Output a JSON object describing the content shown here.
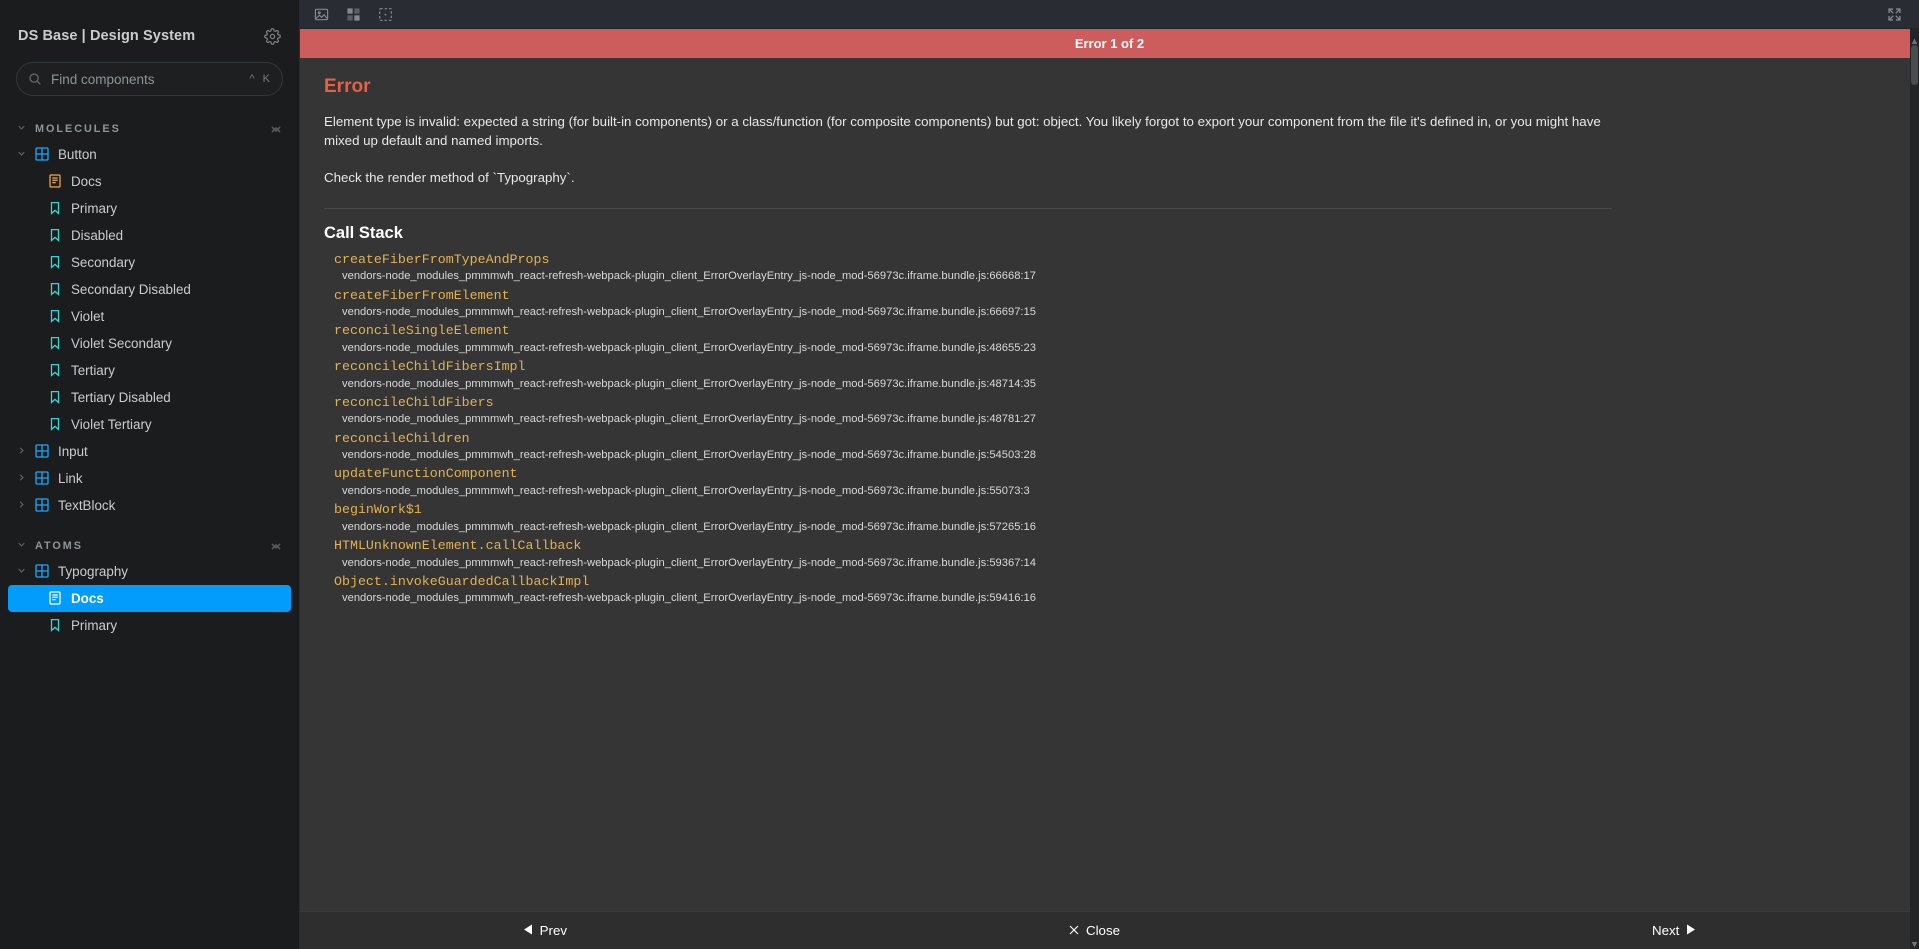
{
  "sidebar": {
    "title": "DS Base | Design System",
    "settings_icon": "gear-icon",
    "search": {
      "placeholder": "Find components",
      "value": "",
      "icon": "search-icon",
      "shortcut_modifier": "^",
      "shortcut_key": "K"
    },
    "groups": [
      {
        "label": "MOLECULES",
        "expanded": true,
        "items": [
          {
            "label": "Button",
            "icon": "component-grid-icon",
            "type": "component",
            "expanded": true,
            "children": [
              {
                "label": "Docs",
                "icon": "docs-page-icon",
                "type": "docs",
                "selected": false
              },
              {
                "label": "Primary",
                "icon": "story-bookmark-icon",
                "type": "story",
                "selected": false
              },
              {
                "label": "Disabled",
                "icon": "story-bookmark-icon",
                "type": "story",
                "selected": false
              },
              {
                "label": "Secondary",
                "icon": "story-bookmark-icon",
                "type": "story",
                "selected": false
              },
              {
                "label": "Secondary Disabled",
                "icon": "story-bookmark-icon",
                "type": "story",
                "selected": false
              },
              {
                "label": "Violet",
                "icon": "story-bookmark-icon",
                "type": "story",
                "selected": false
              },
              {
                "label": "Violet Secondary",
                "icon": "story-bookmark-icon",
                "type": "story",
                "selected": false
              },
              {
                "label": "Tertiary",
                "icon": "story-bookmark-icon",
                "type": "story",
                "selected": false
              },
              {
                "label": "Tertiary Disabled",
                "icon": "story-bookmark-icon",
                "type": "story",
                "selected": false
              },
              {
                "label": "Violet Tertiary",
                "icon": "story-bookmark-icon",
                "type": "story",
                "selected": false
              }
            ]
          },
          {
            "label": "Input",
            "icon": "component-grid-icon",
            "type": "component",
            "expanded": false,
            "children": []
          },
          {
            "label": "Link",
            "icon": "component-grid-icon",
            "type": "component",
            "expanded": false,
            "children": []
          },
          {
            "label": "TextBlock",
            "icon": "component-grid-icon",
            "type": "component",
            "expanded": false,
            "children": []
          }
        ]
      },
      {
        "label": "ATOMS",
        "expanded": true,
        "items": [
          {
            "label": "Typography",
            "icon": "component-grid-icon",
            "type": "component",
            "expanded": true,
            "children": [
              {
                "label": "Docs",
                "icon": "docs-page-icon",
                "type": "docs",
                "selected": true
              },
              {
                "label": "Primary",
                "icon": "story-bookmark-icon",
                "type": "story",
                "selected": false
              }
            ]
          }
        ]
      }
    ]
  },
  "toolbar": {
    "buttons": [
      {
        "name": "change-background-icon",
        "title": "Change the background of the preview"
      },
      {
        "name": "grid-icon",
        "title": "Apply a grid to the preview"
      },
      {
        "name": "measure-icon",
        "title": "Enable measure"
      }
    ],
    "fullscreen": {
      "name": "fullscreen-icon",
      "title": "Go full screen"
    }
  },
  "error_overlay": {
    "banner": "Error 1 of 2",
    "heading": "Error",
    "message_1": "Element type is invalid: expected a string (for built-in components) or a class/function (for composite components) but got: object. You likely forgot to export your component from the file it's defined in, or you might have mixed up default and named imports.",
    "message_2": "Check the render method of `Typography`.",
    "stack_title": "Call Stack",
    "frames": [
      {
        "fn": "createFiberFromTypeAndProps",
        "src": "vendors-node_modules_pmmmwh_react-refresh-webpack-plugin_client_ErrorOverlayEntry_js-node_mod-56973c.iframe.bundle.js:66668:17"
      },
      {
        "fn": "createFiberFromElement",
        "src": "vendors-node_modules_pmmmwh_react-refresh-webpack-plugin_client_ErrorOverlayEntry_js-node_mod-56973c.iframe.bundle.js:66697:15"
      },
      {
        "fn": "reconcileSingleElement",
        "src": "vendors-node_modules_pmmmwh_react-refresh-webpack-plugin_client_ErrorOverlayEntry_js-node_mod-56973c.iframe.bundle.js:48655:23"
      },
      {
        "fn": "reconcileChildFibersImpl",
        "src": "vendors-node_modules_pmmmwh_react-refresh-webpack-plugin_client_ErrorOverlayEntry_js-node_mod-56973c.iframe.bundle.js:48714:35"
      },
      {
        "fn": "reconcileChildFibers",
        "src": "vendors-node_modules_pmmmwh_react-refresh-webpack-plugin_client_ErrorOverlayEntry_js-node_mod-56973c.iframe.bundle.js:48781:27"
      },
      {
        "fn": "reconcileChildren",
        "src": "vendors-node_modules_pmmmwh_react-refresh-webpack-plugin_client_ErrorOverlayEntry_js-node_mod-56973c.iframe.bundle.js:54503:28"
      },
      {
        "fn": "updateFunctionComponent",
        "src": "vendors-node_modules_pmmmwh_react-refresh-webpack-plugin_client_ErrorOverlayEntry_js-node_mod-56973c.iframe.bundle.js:55073:3"
      },
      {
        "fn": "beginWork$1",
        "src": "vendors-node_modules_pmmmwh_react-refresh-webpack-plugin_client_ErrorOverlayEntry_js-node_mod-56973c.iframe.bundle.js:57265:16"
      },
      {
        "fn": "HTMLUnknownElement.callCallback",
        "src": "vendors-node_modules_pmmmwh_react-refresh-webpack-plugin_client_ErrorOverlayEntry_js-node_mod-56973c.iframe.bundle.js:59367:14"
      },
      {
        "fn": "Object.invokeGuardedCallbackImpl",
        "src": "vendors-node_modules_pmmmwh_react-refresh-webpack-plugin_client_ErrorOverlayEntry_js-node_mod-56973c.iframe.bundle.js:59416:16"
      }
    ],
    "footer": {
      "prev": "Prev",
      "prev_icon": "triangle-left-icon",
      "close": "Close",
      "close_icon": "close-x-icon",
      "next": "Next",
      "next_icon": "triangle-right-icon"
    }
  },
  "colors": {
    "accent": "#029cfd",
    "error_banner": "#cd5c5c",
    "error_title": "#e36049",
    "stack_fn": "#e3b14f",
    "sidebar_bg": "#1b1c1d",
    "overlay_bg": "#353535"
  }
}
